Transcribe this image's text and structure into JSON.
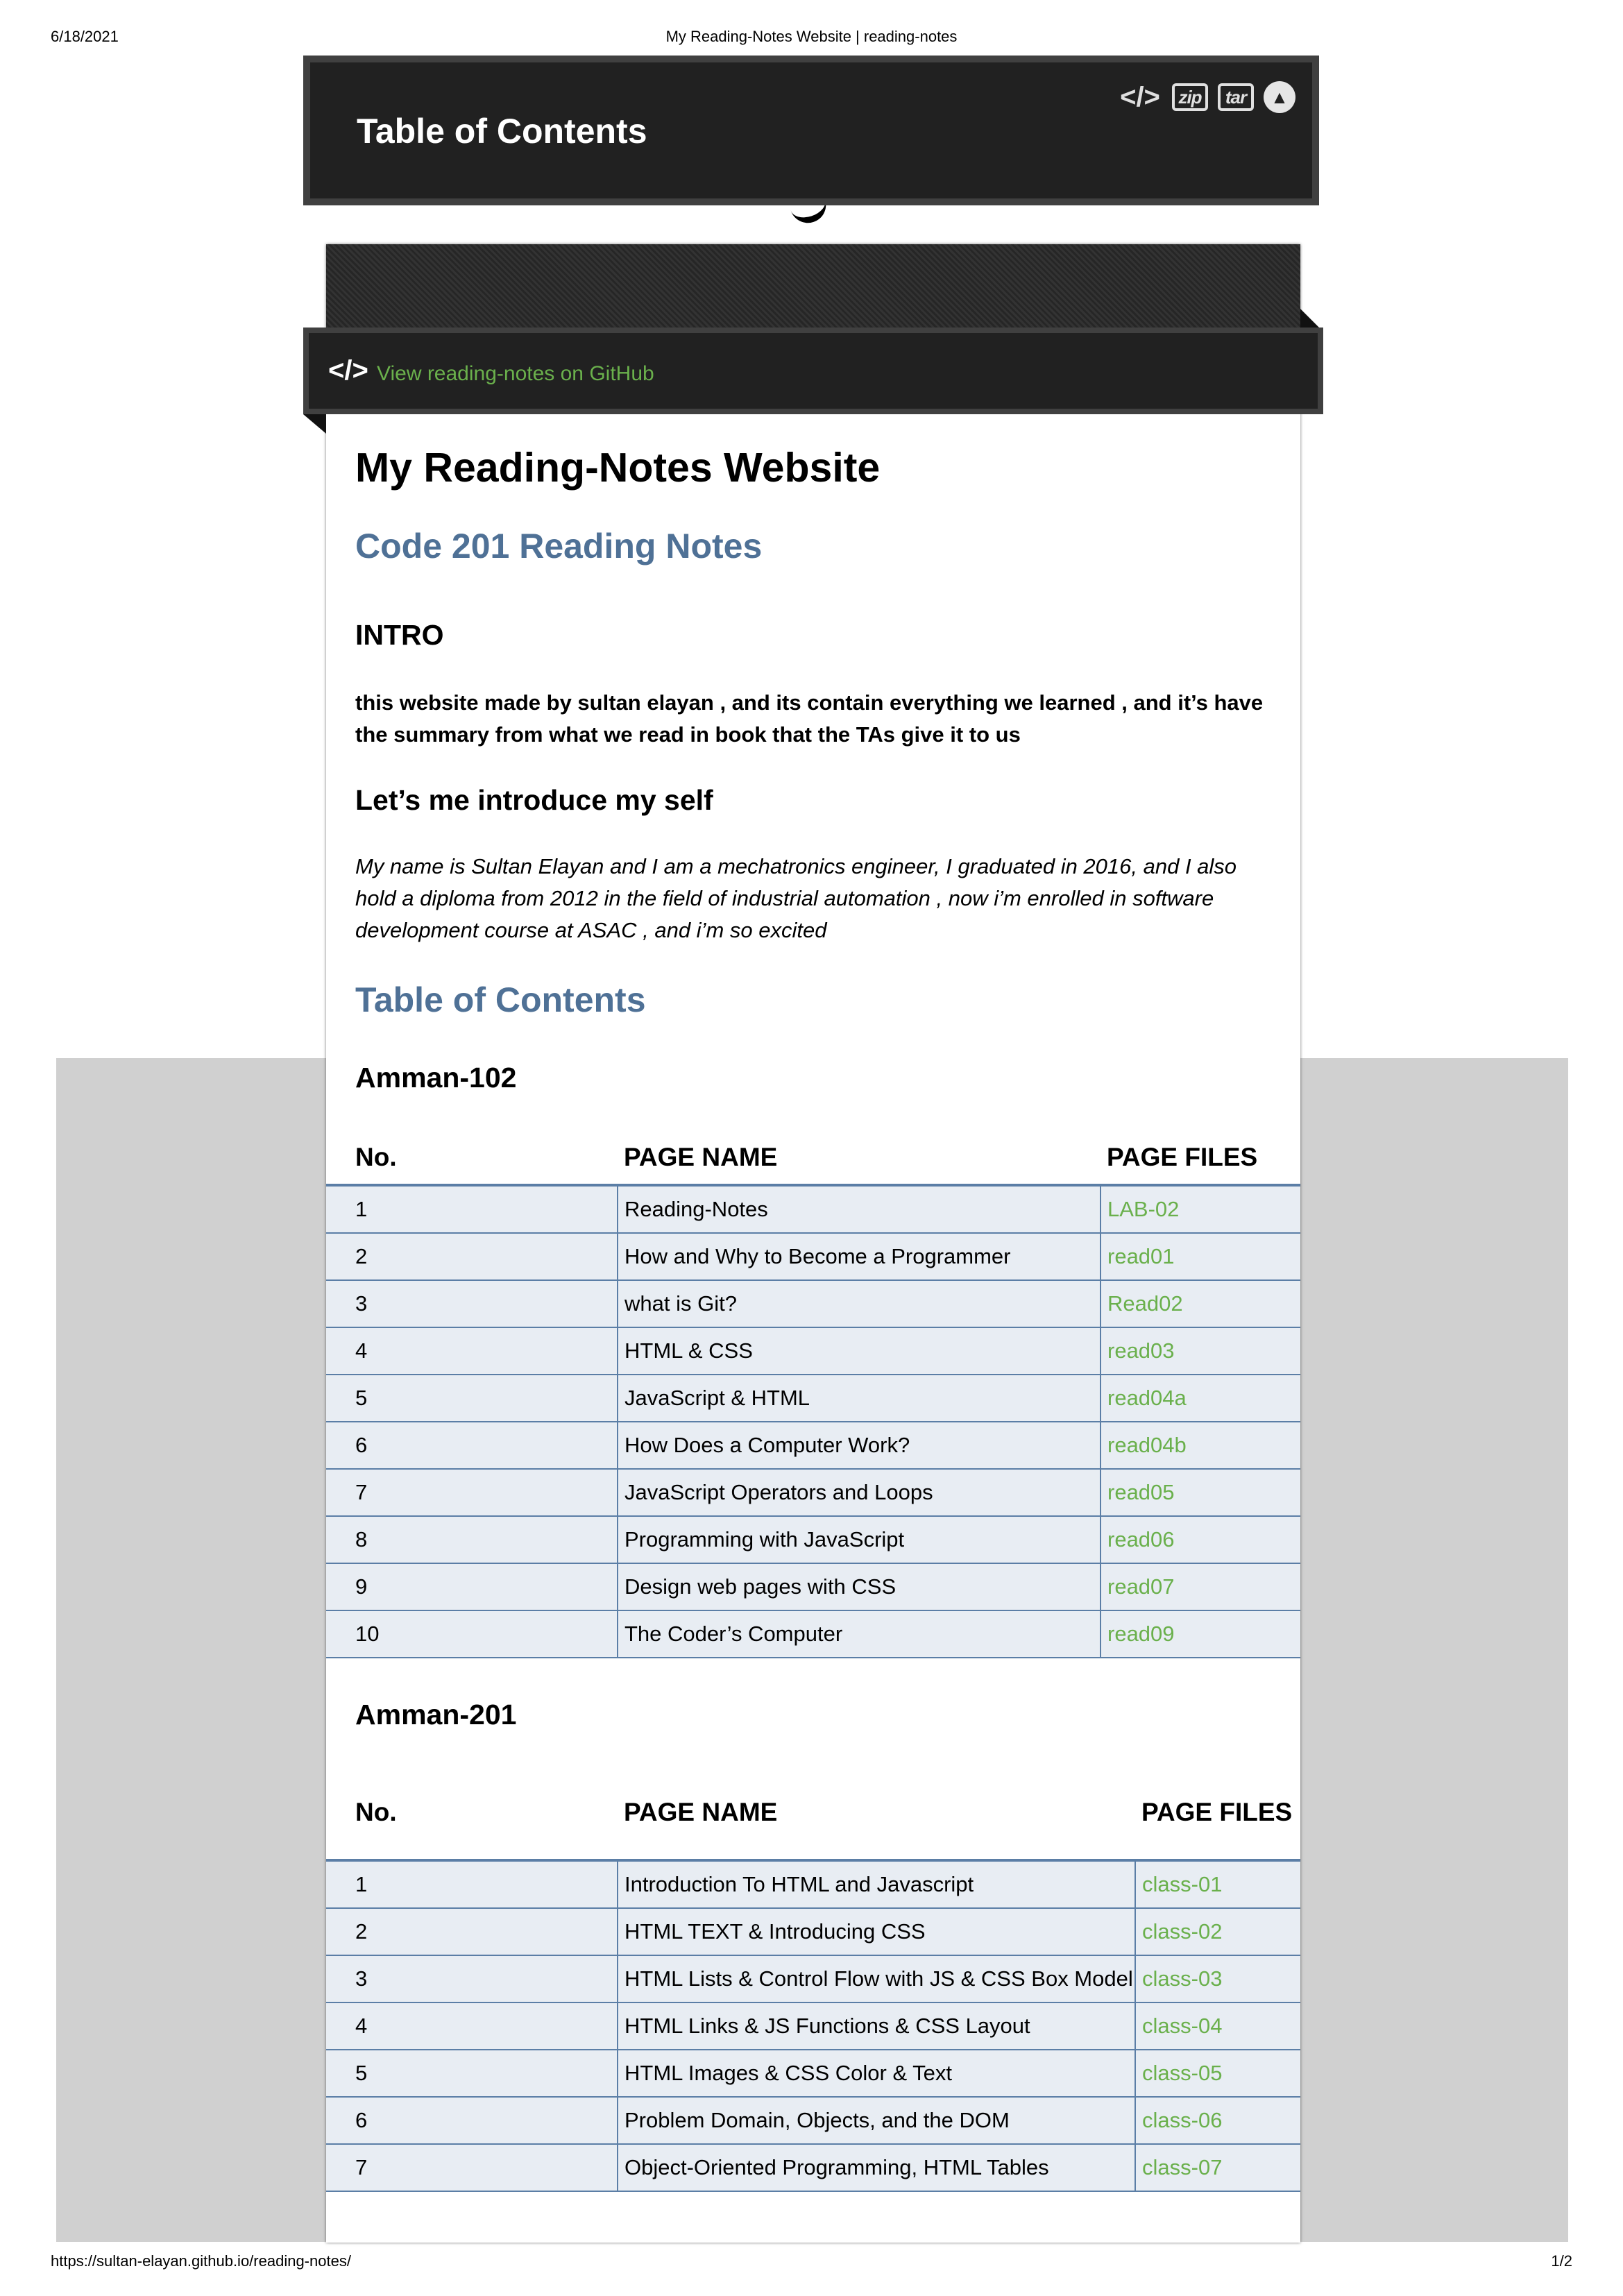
{
  "print": {
    "date": "6/18/2021",
    "title": "My Reading-Notes Website | reading-notes",
    "url": "https://sultan-elayan.github.io/reading-notes/",
    "page": "1/2"
  },
  "toc_bar": {
    "title": "Table of Contents",
    "icons": [
      "code-icon",
      "zip-download-icon",
      "tar-download-icon",
      "scroll-up-icon"
    ],
    "zip_label": "zip",
    "tar_label": "tar"
  },
  "github_bar": {
    "link_text": "View reading-notes on GitHub",
    "icon": "code-icon"
  },
  "main": {
    "title": "My Reading-Notes Website",
    "subtitle": "Code 201 Reading Notes",
    "intro_heading": "INTRO",
    "intro_text": "this website made by sultan elayan , and its contain everything we learned , and it’s have the summary from what we read in book that the TAs give it to us",
    "about_heading": "Let’s me introduce my self",
    "about_text": "My name is Sultan Elayan and I am a mechatronics engineer, I graduated in 2016, and I also hold a diploma from 2012 in the field of industrial automation , now i’m enrolled in software development course at ASAC , and i’m so excited",
    "toc_heading": "Table of Contents"
  },
  "table_headers": {
    "no": "No.",
    "name": "PAGE NAME",
    "files": "PAGE FILES"
  },
  "section_102": {
    "title": "Amman-102",
    "rows": [
      {
        "no": "1",
        "name": "Reading-Notes",
        "file": "LAB-02"
      },
      {
        "no": "2",
        "name": "How and Why to Become a Programmer",
        "file": "read01"
      },
      {
        "no": "3",
        "name": "what is Git?",
        "file": "Read02"
      },
      {
        "no": "4",
        "name": "HTML & CSS",
        "file": "read03"
      },
      {
        "no": "5",
        "name": "JavaScript & HTML",
        "file": "read04a"
      },
      {
        "no": "6",
        "name": "How Does a Computer Work?",
        "file": "read04b"
      },
      {
        "no": "7",
        "name": "JavaScript Operators and Loops",
        "file": "read05"
      },
      {
        "no": "8",
        "name": "Programming with JavaScript",
        "file": "read06"
      },
      {
        "no": "9",
        "name": "Design web pages with CSS",
        "file": "read07"
      },
      {
        "no": "10",
        "name": "The Coder’s Computer",
        "file": "read09"
      }
    ]
  },
  "section_201": {
    "title": "Amman-201",
    "rows": [
      {
        "no": "1",
        "name": "Introduction To HTML and Javascript",
        "file": "class-01"
      },
      {
        "no": "2",
        "name": "HTML TEXT & Introducing CSS",
        "file": "class-02"
      },
      {
        "no": "3",
        "name": "HTML Lists & Control Flow with JS & CSS Box Model",
        "file": "class-03"
      },
      {
        "no": "4",
        "name": "HTML Links & JS Functions & CSS Layout",
        "file": "class-04"
      },
      {
        "no": "5",
        "name": "HTML Images & CSS Color & Text",
        "file": "class-05"
      },
      {
        "no": "6",
        "name": "Problem Domain, Objects, and the DOM",
        "file": "class-06"
      },
      {
        "no": "7",
        "name": "Object-Oriented Programming, HTML Tables",
        "file": "class-07"
      }
    ]
  },
  "colors": {
    "accent_link": "#6ab04c",
    "heading_blue": "#4f7196",
    "bar_dark": "#212121",
    "table_border": "#5b7ea6",
    "table_cell_bg": "#e8edf3"
  }
}
